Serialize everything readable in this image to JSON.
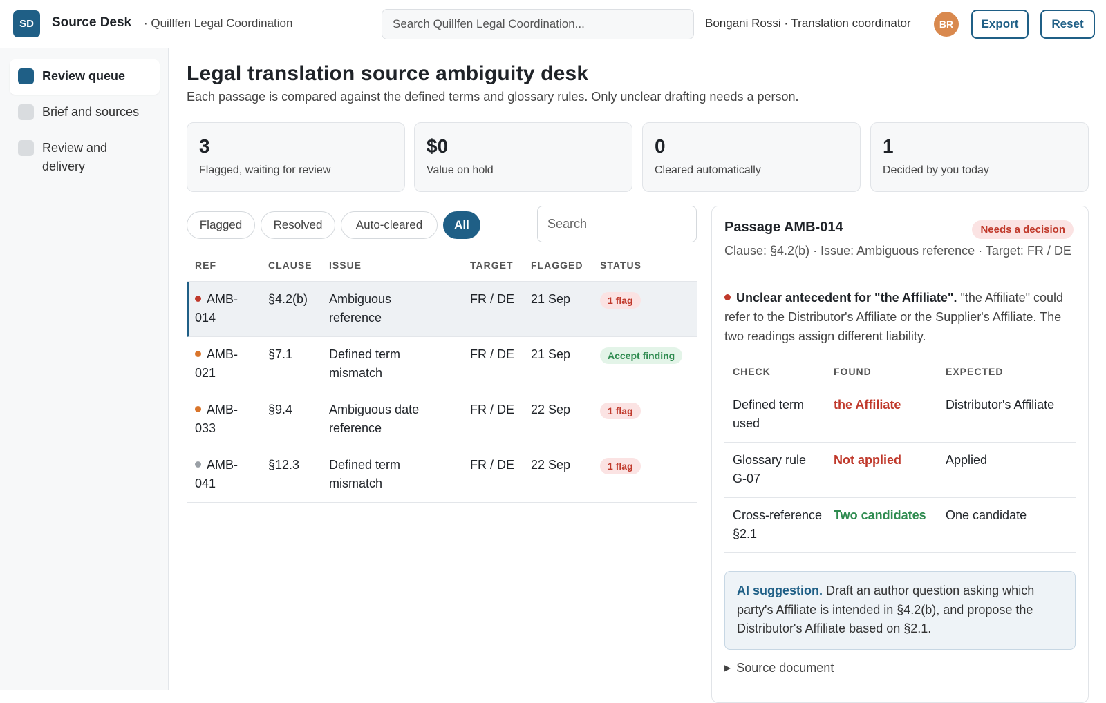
{
  "app": {
    "logo_text": "SD",
    "name": "Source Desk",
    "org": "· Quillfen Legal Coordination",
    "search_placeholder": "Search Quillfen Legal Coordination...",
    "user": "Bongani Rossi · Translation coordinator",
    "user_initials": "BR",
    "export_label": "Export",
    "reset_label": "Reset"
  },
  "sidebar": {
    "items": [
      {
        "label": "Review queue",
        "active": true
      },
      {
        "label": "Brief and sources",
        "active": false
      },
      {
        "label": "Review and delivery",
        "active": false
      }
    ]
  },
  "page": {
    "title": "Legal translation source ambiguity desk",
    "subtitle": "Each passage is compared against the defined terms and glossary rules. Only unclear drafting needs a person."
  },
  "stats": [
    {
      "value": "3",
      "label": "Flagged, waiting for review"
    },
    {
      "value": "$0",
      "label": "Value on hold"
    },
    {
      "value": "0",
      "label": "Cleared automatically"
    },
    {
      "value": "1",
      "label": "Decided by you today"
    }
  ],
  "filters": {
    "chips": [
      "Flagged",
      "Resolved",
      "Auto-cleared",
      "All"
    ],
    "active": "All",
    "search_placeholder": "Search"
  },
  "queue": {
    "headers": [
      "REF",
      "CLAUSE",
      "ISSUE",
      "TARGET",
      "FLAGGED",
      "STATUS"
    ],
    "rows": [
      {
        "ref": "AMB-014",
        "clause": "§4.2(b)",
        "issue": "Ambiguous reference",
        "target": "FR / DE",
        "flagged": "21 Sep",
        "status": "1 flag",
        "status_kind": "flag",
        "dot": "#c0392b"
      },
      {
        "ref": "AMB-021",
        "clause": "§7.1",
        "issue": "Defined term mismatch",
        "target": "FR / DE",
        "flagged": "21 Sep",
        "status": "Accept finding",
        "status_kind": "ok",
        "dot": "#d9752b"
      },
      {
        "ref": "AMB-033",
        "clause": "§9.4",
        "issue": "Ambiguous date reference",
        "target": "FR / DE",
        "flagged": "22 Sep",
        "status": "1 flag",
        "status_kind": "flag",
        "dot": "#d9752b"
      },
      {
        "ref": "AMB-041",
        "clause": "§12.3",
        "issue": "Defined term mismatch",
        "target": "FR / DE",
        "flagged": "22 Sep",
        "status": "1 flag",
        "status_kind": "flag",
        "dot": "#9aa0a6"
      }
    ]
  },
  "detail": {
    "title": "Passage AMB-014",
    "badge": "Needs a decision",
    "meta": "Clause: §4.2(b) · Issue: Ambiguous reference · Target: FR / DE",
    "finding_title": "Unclear antecedent for \"the Affiliate\".",
    "finding_text": "\"the Affiliate\" could refer to the Distributor's Affiliate or the Supplier's Affiliate. The two readings assign different liability.",
    "check_headers": [
      "CHECK",
      "FOUND",
      "EXPECTED"
    ],
    "checks": [
      {
        "check": "Defined term used",
        "found": "the Affiliate",
        "found_kind": "bad",
        "expected": "Distributor's Affiliate"
      },
      {
        "check": "Glossary rule G-07",
        "found": "Not applied",
        "found_kind": "bad",
        "expected": "Applied"
      },
      {
        "check": "Cross-reference §2.1",
        "found": "Two candidates",
        "found_kind": "good",
        "expected": "One candidate"
      }
    ],
    "ai_label": "AI suggestion.",
    "ai_text": "Draft an author question asking which party's Affiliate is intended in §4.2(b), and propose the Distributor's Affiliate based on §2.1.",
    "source_doc": "Source document"
  }
}
